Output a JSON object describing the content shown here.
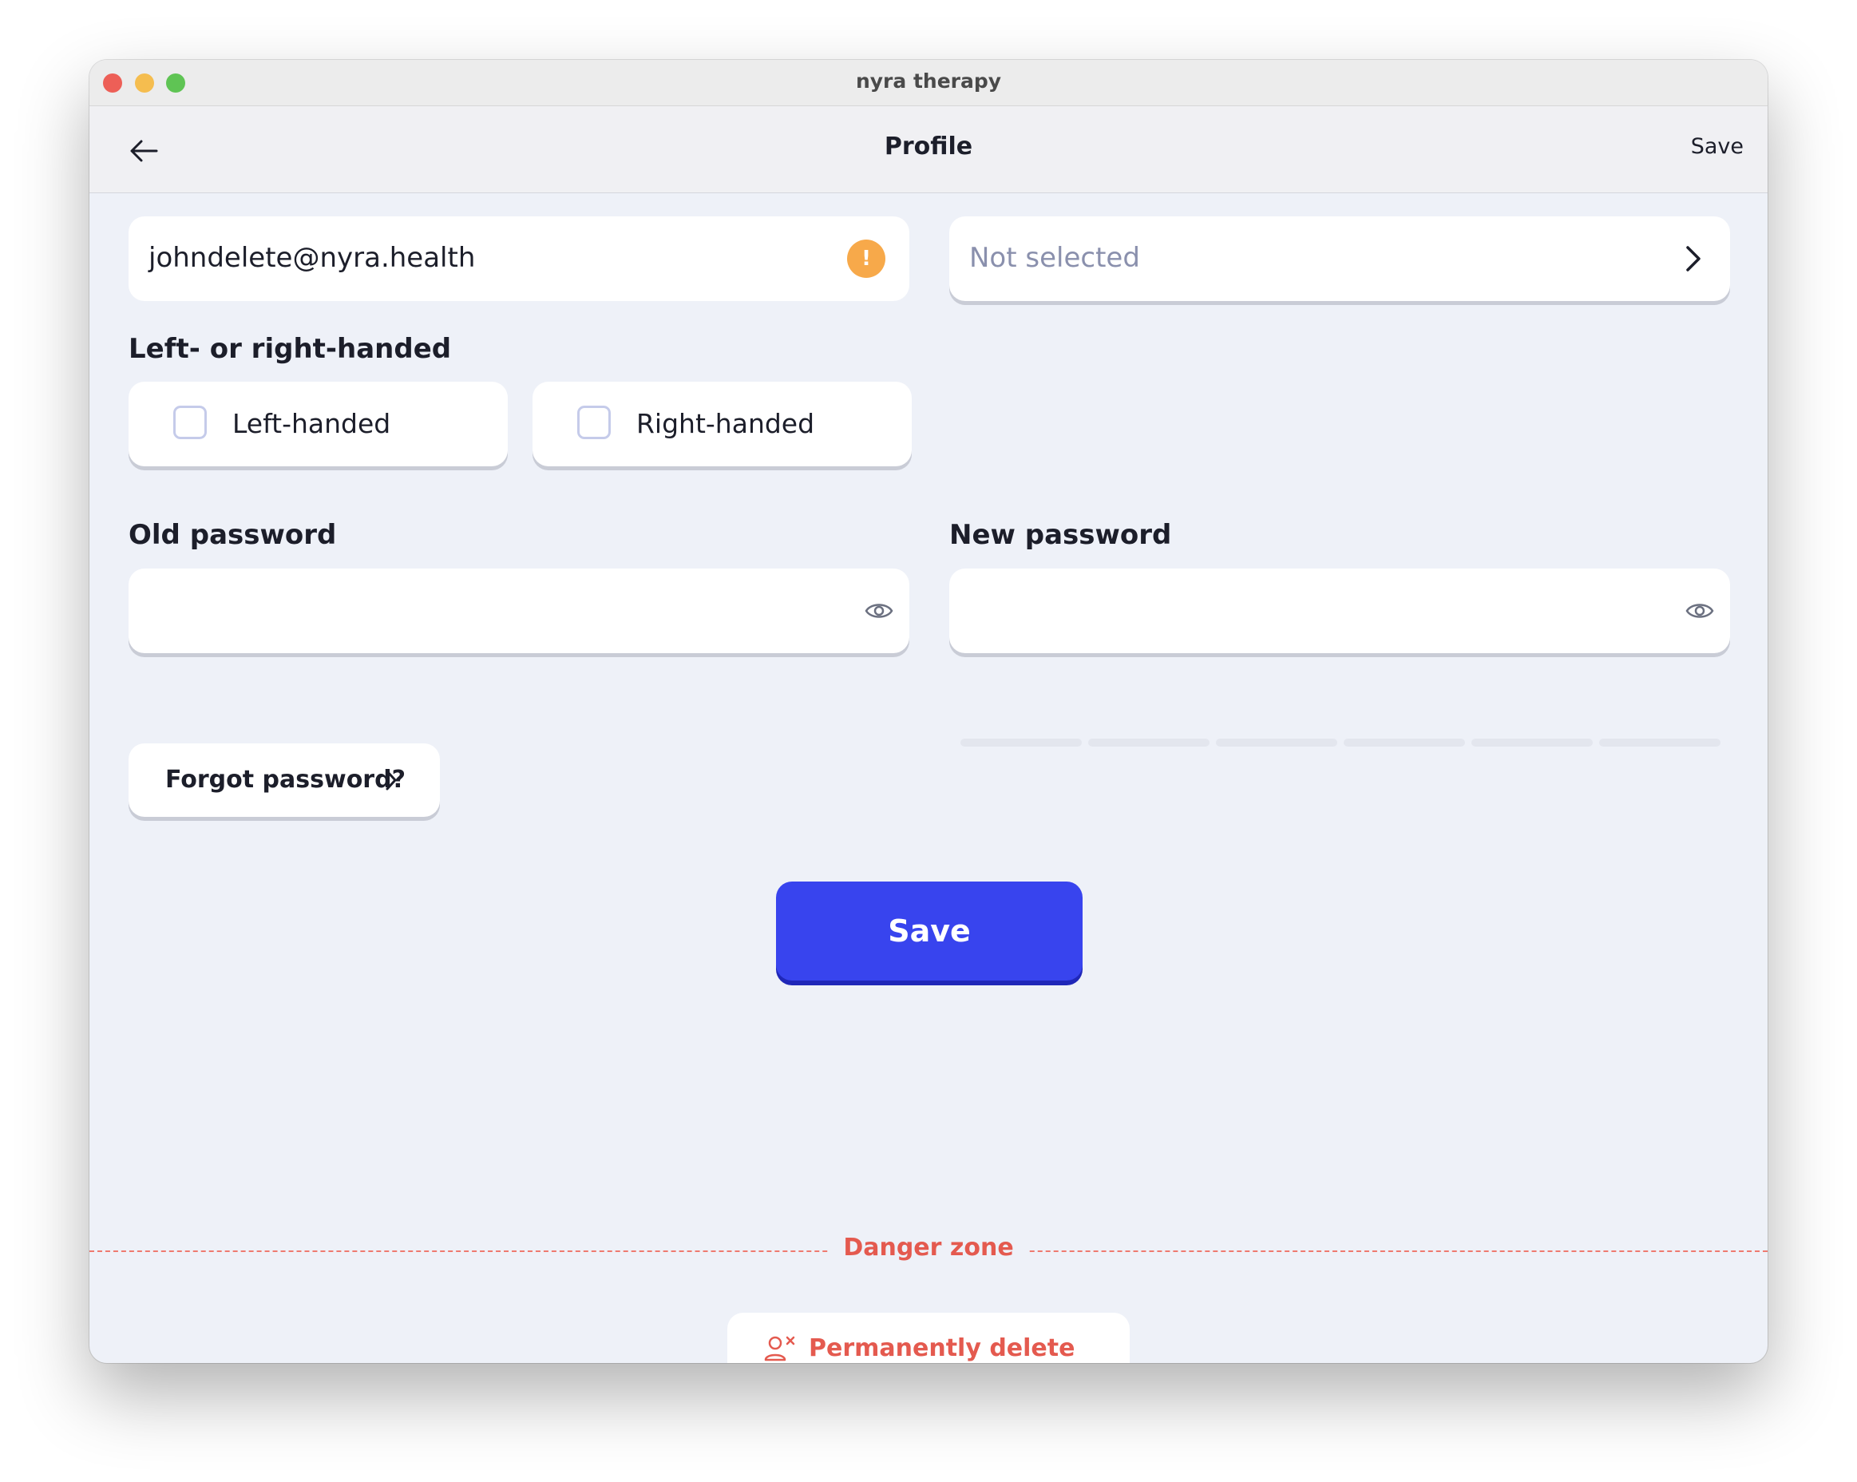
{
  "window": {
    "title": "nyra therapy"
  },
  "navbar": {
    "title": "Profile",
    "save_label": "Save",
    "back_icon": "arrow-left-icon"
  },
  "email": {
    "value": "johndelete@nyra.health",
    "warning_icon": "!"
  },
  "select": {
    "value": "Not selected"
  },
  "handedness": {
    "label": "Left- or right-handed",
    "options": [
      {
        "label": "Left-handed",
        "checked": false
      },
      {
        "label": "Right-handed",
        "checked": false
      }
    ]
  },
  "old_password": {
    "label": "Old password",
    "value": ""
  },
  "new_password": {
    "label": "New password",
    "value": "",
    "strength_segments": 6
  },
  "forgot_password": {
    "label": "Forgot password?"
  },
  "main_save": {
    "label": "Save"
  },
  "danger_zone": {
    "label": "Danger zone",
    "delete_label": "Permanently delete profile"
  },
  "colors": {
    "primary": "#3844ee",
    "danger": "#e45a4f",
    "warning": "#f7a94a",
    "background": "#eef1f8"
  }
}
